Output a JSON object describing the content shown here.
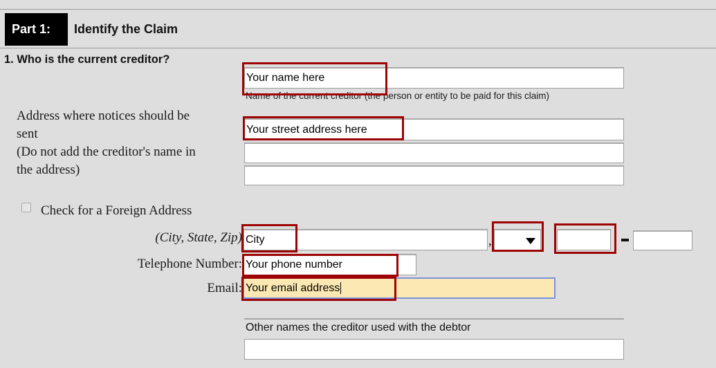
{
  "header": {
    "part_label": "Part 1:",
    "part_title": "Identify the Claim"
  },
  "question": {
    "number_and_text": "1. Who is the current creditor?"
  },
  "creditor_name": {
    "value": "Your name here",
    "caption": "Name of the current creditor (the person or entity to be paid for this claim)"
  },
  "address": {
    "label_line1": "Address where notices should be",
    "label_line2": "sent",
    "label_line3": "(Do not add the creditor's name in",
    "label_line4": "the address)",
    "line1_value": "Your street address here",
    "line2_value": "",
    "line3_value": ""
  },
  "foreign_address": {
    "label": "Check for a Foreign Address",
    "checked": false
  },
  "city_state_zip": {
    "hint": "(City, State, Zip)",
    "city_value": "City",
    "comma": ",",
    "state_value": "",
    "zip_value": "",
    "zip_ext_value": ""
  },
  "telephone": {
    "label": "Telephone Number:",
    "value": "Your phone number"
  },
  "email": {
    "label": "Email:",
    "value": "Your email address",
    "focused": true,
    "fill_color": "#fce8b2",
    "border_color": "#7b92e0"
  },
  "other_names": {
    "label": "Other names the creditor used with the debtor",
    "value": ""
  },
  "annotation": {
    "color": "#9e0303"
  }
}
